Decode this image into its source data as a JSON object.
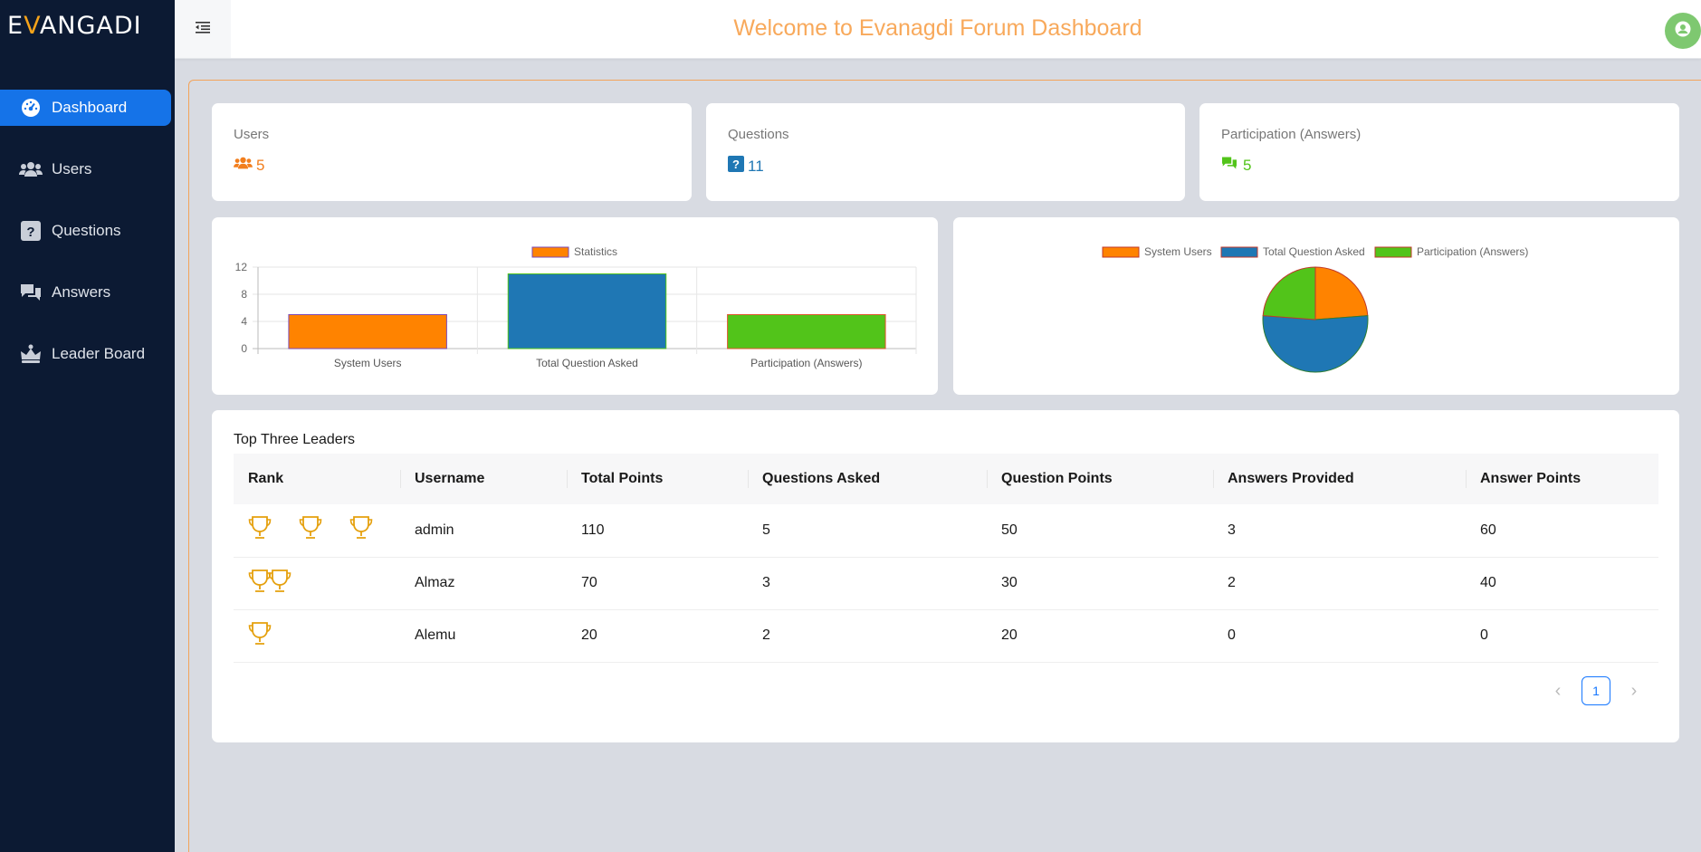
{
  "brand": {
    "logo_prefix": "E",
    "logo_v": "V",
    "logo_rest": "ANGADI"
  },
  "header": {
    "title": "Welcome to Evanagdi Forum Dashboard"
  },
  "sidebar": {
    "items": [
      {
        "label": "Dashboard",
        "icon": "gauge-icon",
        "active": true
      },
      {
        "label": "Users",
        "icon": "users-icon",
        "active": false
      },
      {
        "label": "Questions",
        "icon": "question-icon",
        "active": false
      },
      {
        "label": "Answers",
        "icon": "comments-icon",
        "active": false
      },
      {
        "label": "Leader Board",
        "icon": "crown-icon",
        "active": false
      }
    ]
  },
  "stats": {
    "users": {
      "title": "Users",
      "value": "5",
      "color": "#f27e1d"
    },
    "questions": {
      "title": "Questions",
      "value": "11",
      "color": "#1f77b4"
    },
    "answers": {
      "title": "Participation (Answers)",
      "value": "5",
      "color": "#52c41a"
    }
  },
  "chart_data": [
    {
      "type": "bar",
      "legend": [
        "Statistics"
      ],
      "categories": [
        "System Users",
        "Total Question Asked",
        "Participation (Answers)"
      ],
      "values": [
        5,
        11,
        5
      ],
      "colors": [
        "#ff8300",
        "#1f77b4",
        "#52c41a"
      ],
      "ylim": [
        0,
        12
      ],
      "yticks": [
        "0",
        "4",
        "8",
        "12"
      ],
      "grid": true
    },
    {
      "type": "pie",
      "legend": [
        "System Users",
        "Total Question Asked",
        "Participation (Answers)"
      ],
      "values": [
        5,
        11,
        5
      ],
      "colors": [
        "#ff8300",
        "#1f77b4",
        "#52c41a"
      ]
    }
  ],
  "leaders": {
    "title": "Top Three Leaders",
    "columns": [
      "Rank",
      "Username",
      "Total Points",
      "Questions Asked",
      "Question Points",
      "Answers Provided",
      "Answer Points"
    ],
    "rows": [
      {
        "cups": 3,
        "username": "admin",
        "total": "110",
        "qasked": "5",
        "qpoints": "50",
        "aprovided": "3",
        "apoints": "60"
      },
      {
        "cups": 2,
        "username": "Almaz",
        "total": "70",
        "qasked": "3",
        "qpoints": "30",
        "aprovided": "2",
        "apoints": "40"
      },
      {
        "cups": 1,
        "username": "Alemu",
        "total": "20",
        "qasked": "2",
        "qpoints": "20",
        "aprovided": "0",
        "apoints": "0"
      }
    ],
    "page": "1"
  }
}
